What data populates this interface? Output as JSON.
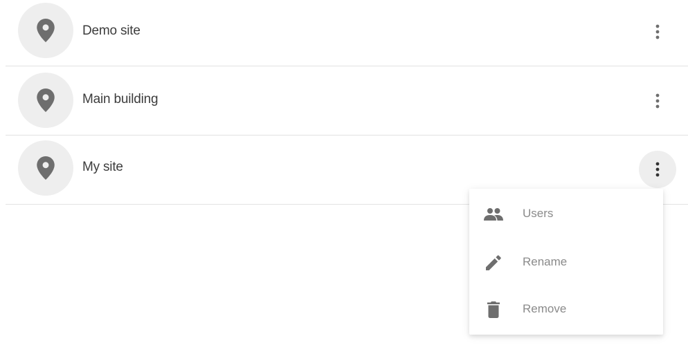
{
  "sites": [
    {
      "name": "Demo site",
      "icon": "location-pin-icon",
      "menu_open": false
    },
    {
      "name": "Main building",
      "icon": "location-pin-icon",
      "menu_open": false
    },
    {
      "name": "My site",
      "icon": "location-pin-icon",
      "menu_open": true
    }
  ],
  "context_menu": {
    "items": [
      {
        "label": "Users",
        "icon": "users-icon"
      },
      {
        "label": "Rename",
        "icon": "pencil-icon"
      },
      {
        "label": "Remove",
        "icon": "trash-icon"
      }
    ]
  },
  "colors": {
    "icon_gray": "#6e6e6e",
    "avatar_bg": "#eeeeee",
    "divider": "#e2e2e2",
    "text_primary": "#3c3c3c",
    "text_menu": "#8a8a8a"
  }
}
